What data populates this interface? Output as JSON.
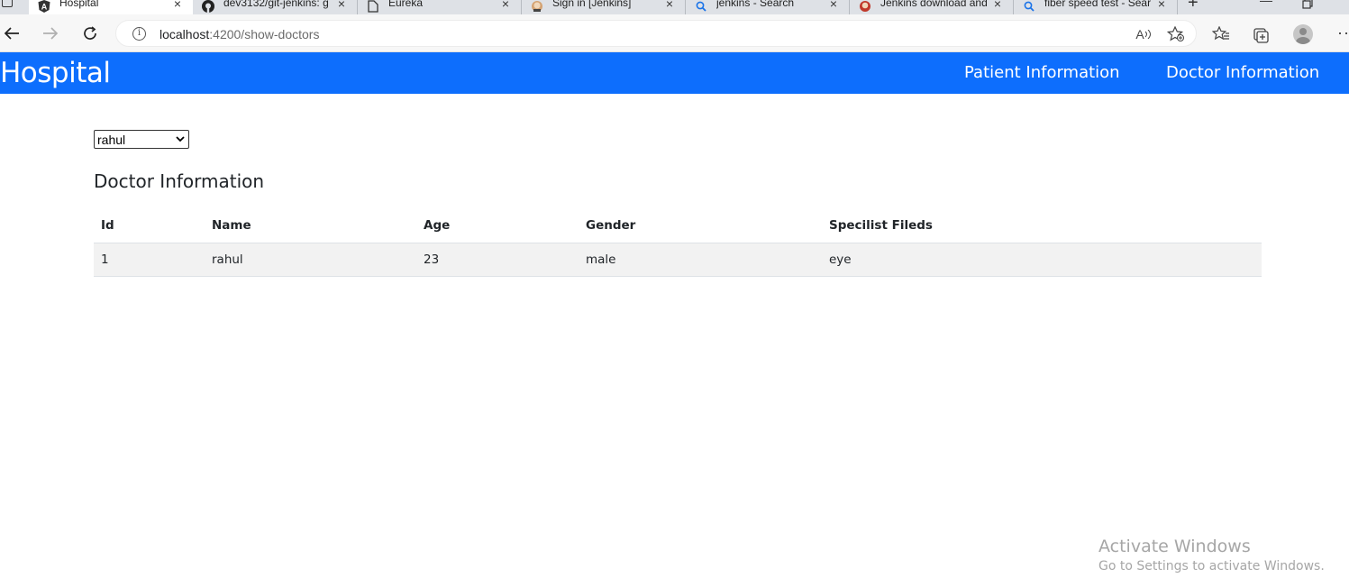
{
  "browser": {
    "tabs": [
      {
        "title": "Hospital",
        "icon": "angular-icon",
        "active": true
      },
      {
        "title": "dev3132/git-jenkins: g",
        "icon": "github-icon",
        "active": false
      },
      {
        "title": "Eureka",
        "icon": "page-icon",
        "active": false
      },
      {
        "title": "Sign in [Jenkins]",
        "icon": "jenkins-icon",
        "active": false
      },
      {
        "title": "jenkins - Search",
        "icon": "search-icon",
        "active": false
      },
      {
        "title": "Jenkins download and",
        "icon": "jenkins-icon",
        "active": false
      },
      {
        "title": "fiber speed test - Sear",
        "icon": "search-icon",
        "active": false
      }
    ],
    "url_host": "localhost",
    "url_path": ":4200/show-doctors",
    "read_aloud_label": "A",
    "close_glyph": "×"
  },
  "app": {
    "brand": "Hospital",
    "nav": {
      "patient": "Patient Information",
      "doctor": "Doctor Information"
    },
    "accent_color": "#0d6efd"
  },
  "content": {
    "select": {
      "value": "rahul",
      "options": [
        "rahul"
      ]
    },
    "heading": "Doctor Information",
    "table": {
      "headers": [
        "Id",
        "Name",
        "Age",
        "Gender",
        "Specilist Fileds"
      ],
      "rows": [
        [
          "1",
          "rahul",
          "23",
          "male",
          "eye"
        ]
      ]
    }
  },
  "watermark": {
    "title": "Activate Windows",
    "subtitle": "Go to Settings to activate Windows."
  }
}
